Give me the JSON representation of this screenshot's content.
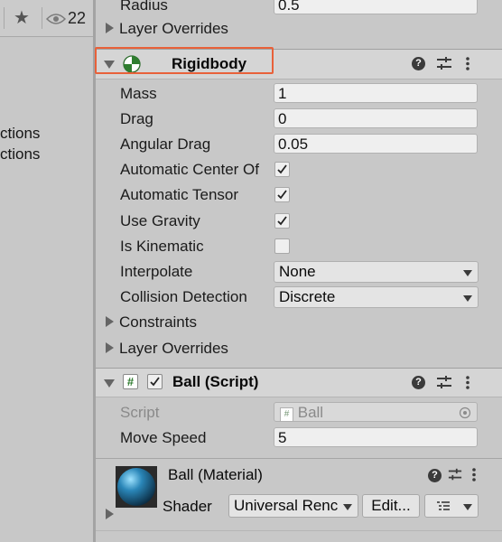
{
  "left": {
    "eye_count": "22",
    "lines": [
      "ctions",
      "ctions"
    ]
  },
  "top_partial": {
    "radius_label": "Radius",
    "radius_value": "0.5",
    "layer_overrides": "Layer Overrides"
  },
  "rigidbody": {
    "title": "Rigidbody",
    "fields": {
      "mass_label": "Mass",
      "mass_value": "1",
      "drag_label": "Drag",
      "drag_value": "0",
      "angular_drag_label": "Angular Drag",
      "angular_drag_value": "0.05",
      "auto_center_label": "Automatic Center Of",
      "auto_tensor_label": "Automatic Tensor",
      "use_gravity_label": "Use Gravity",
      "is_kinematic_label": "Is Kinematic",
      "interpolate_label": "Interpolate",
      "interpolate_value": "None",
      "collision_label": "Collision Detection",
      "collision_value": "Discrete"
    },
    "checks": {
      "auto_center": true,
      "auto_tensor": true,
      "use_gravity": true,
      "is_kinematic": false
    },
    "constraints": "Constraints",
    "layer_overrides": "Layer Overrides",
    "highlight_color": "#e8613a"
  },
  "ball_script": {
    "title": "Ball (Script)",
    "script_label": "Script",
    "script_value": "Ball",
    "move_speed_label": "Move Speed",
    "move_speed_value": "5"
  },
  "material": {
    "title": "Ball (Material)",
    "shader_label": "Shader",
    "shader_value": "Universal Renc",
    "edit_label": "Edit...",
    "sphere_color": "#2a86b8"
  },
  "icons": [
    "star-icon",
    "eye-icon",
    "rigidbody-icon",
    "help-icon",
    "preset-icon",
    "kebab-icon",
    "script-icon",
    "target-icon",
    "list-icon"
  ]
}
